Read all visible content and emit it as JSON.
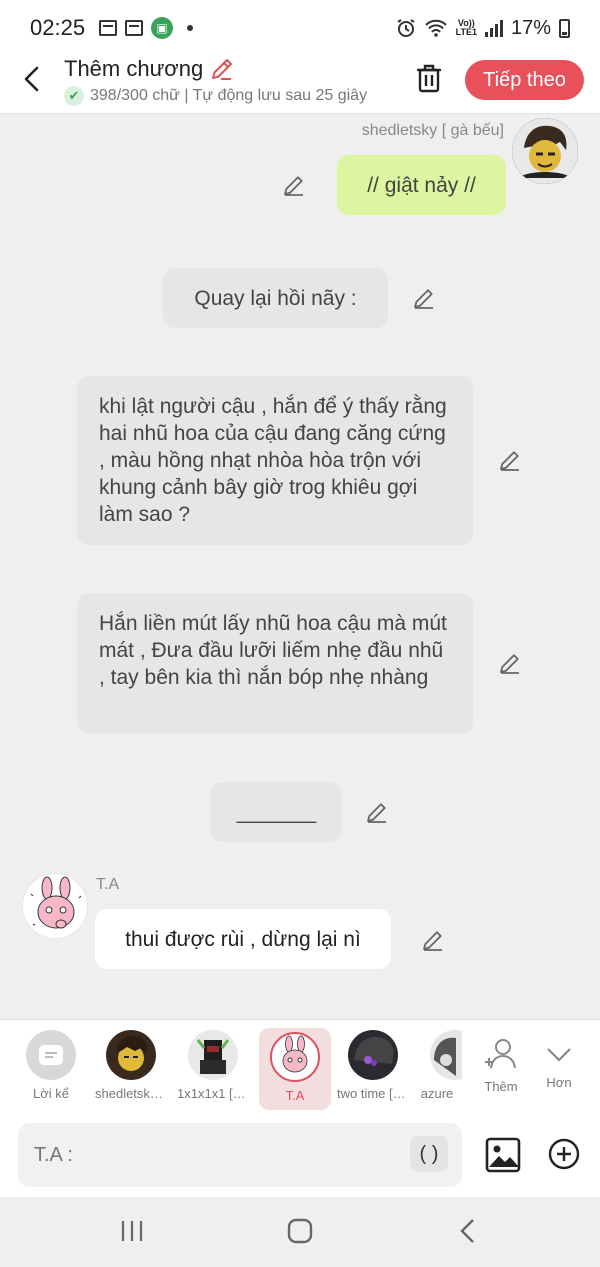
{
  "status_bar": {
    "time": "02:25",
    "battery": "17%",
    "lte": "Vo))\nLTE1"
  },
  "header": {
    "title": "Thêm chương",
    "subtitle": "398/300 chữ | Tự động lưu sau 25 giây",
    "next_label": "Tiếp theo"
  },
  "messages": [
    {
      "speaker": "shedletsky [ gà bếu]",
      "text": "// giật nảy //"
    },
    {
      "text": "Quay lại hồi nãy :"
    },
    {
      "text": "khi lật người cậu , hắn để ý thấy rằng hai nhũ hoa của cậu đang căng cứng , màu hồng nhạt nhòa hòa trộn với khung cảnh bây giờ trog khiêu gợi làm sao ?"
    },
    {
      "text": "Hắn liền mút lấy nhũ hoa cậu mà mút mát , Đưa đầu lưỡi liếm nhẹ đầu nhũ , tay bên kia thì nắn bóp nhẹ nhàng"
    },
    {
      "text": "________"
    },
    {
      "speaker": "T.A",
      "text": "thui được rùi , dừng lại nì"
    }
  ],
  "characters": [
    {
      "label": "Lời kể"
    },
    {
      "label": "shedletsky [ gà bếu]"
    },
    {
      "label": "1x1x1x1 [ ... ]"
    },
    {
      "label": "T.A"
    },
    {
      "label": "two time [ ... ]"
    },
    {
      "label": "azure"
    }
  ],
  "add_character_label": "Thêm",
  "more_label": "Hơn",
  "input": {
    "placeholder": "T.A :",
    "paren_label": "( )"
  },
  "colors": {
    "accent": "#e8505b",
    "user_bubble": "#dcf5a0",
    "narration_bubble": "#e6e6e6",
    "selected_tab": "#f2dedf"
  }
}
